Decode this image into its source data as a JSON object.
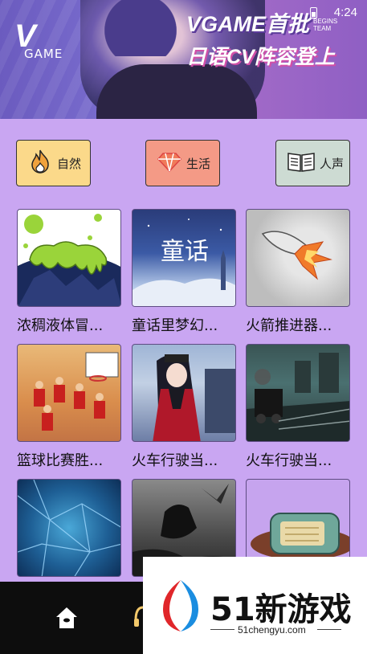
{
  "status_bar": {
    "time": "4:24"
  },
  "banner": {
    "logo_letter": "V",
    "logo_text": "GAME",
    "headline_1": "VGAME首批",
    "headline_2": "日语CV阵容登上",
    "sub_1": "BEGINS",
    "sub_2": "TEAM"
  },
  "categories": [
    {
      "label": "自然",
      "icon": "flame-icon"
    },
    {
      "label": "生活",
      "icon": "diamond-icon"
    },
    {
      "label": "人声",
      "icon": "book-icon"
    }
  ],
  "grid": {
    "items": [
      {
        "caption": "浓稠液体冒...",
        "image": "green-slime"
      },
      {
        "caption": "童话里梦幻...",
        "image": "fairy-tale",
        "overlay": "童话"
      },
      {
        "caption": "火箭推进器...",
        "image": "rocket"
      },
      {
        "caption": "篮球比赛胜...",
        "image": "basketball"
      },
      {
        "caption": "火车行驶当...",
        "image": "anime-girl-train"
      },
      {
        "caption": "火车行驶当...",
        "image": "steam-train"
      },
      {
        "caption": "",
        "image": "ice-crackle"
      },
      {
        "caption": "",
        "image": "ravens"
      },
      {
        "caption": "",
        "image": "retro-radio"
      }
    ]
  },
  "bottom_nav": {
    "items": [
      "home-icon",
      "headphones-icon"
    ]
  },
  "watermark": {
    "title": "51新游戏",
    "url": "51chengyu.com"
  }
}
